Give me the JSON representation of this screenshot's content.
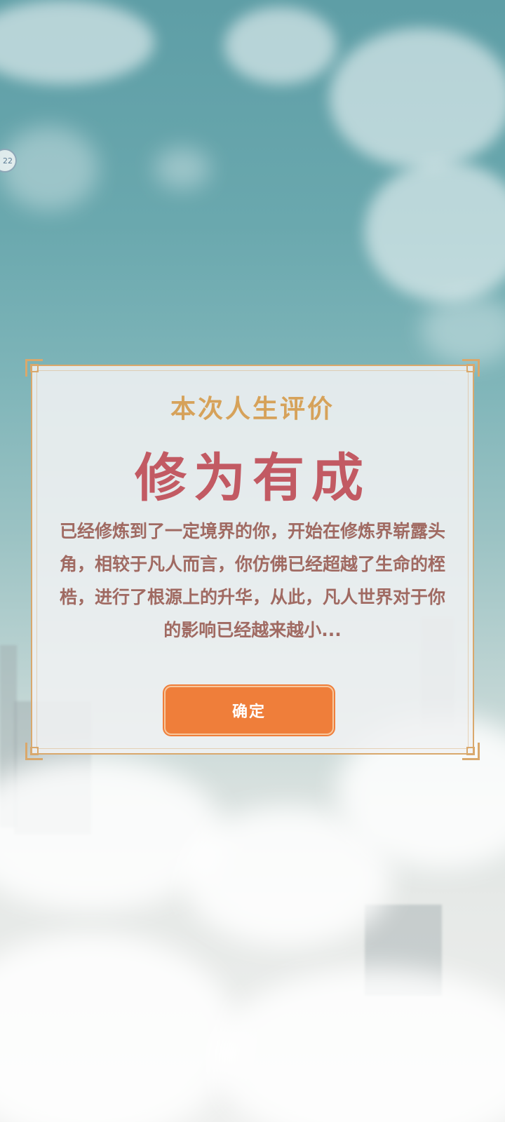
{
  "status": {
    "avatar_text": "22"
  },
  "dialog": {
    "subtitle": "本次人生评价",
    "rank_title": "修为有成",
    "description": "已经修炼到了一定境界的你，开始在修炼界崭露头角，相较于凡人而言，你仿佛已经超越了生命的桎梏，进行了根源上的升华，从此，凡人世界对于你的影响已经越来越小...",
    "confirm_label": "确定"
  },
  "colors": {
    "accent": "#ef7e3a",
    "frame": "#d9a86c",
    "subtitle": "#d6a25a",
    "rank_title": "#c25a63",
    "description": "#a06a62"
  }
}
